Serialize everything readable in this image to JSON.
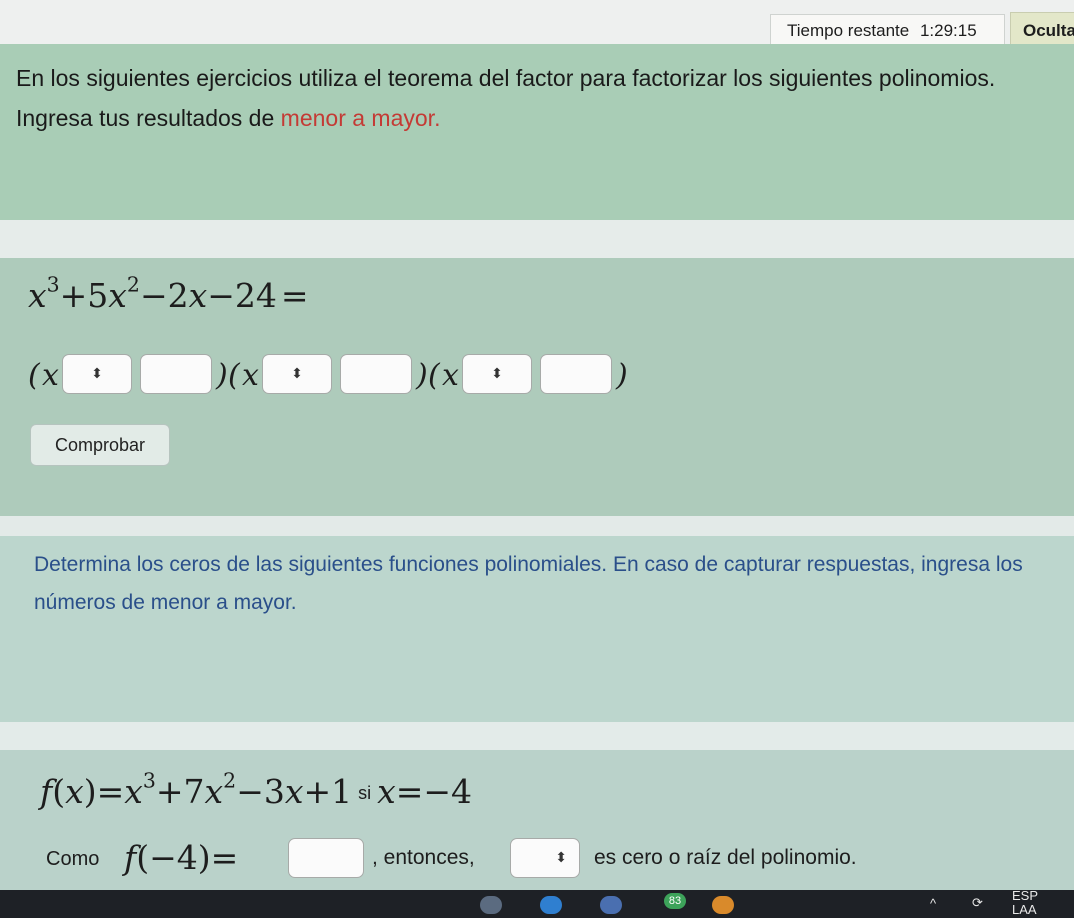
{
  "header": {
    "timer_label": "Tiempo restante",
    "timer_value": "1:29:15",
    "hide_button": "Oculta"
  },
  "section1": {
    "instruction_before": "En los siguientes ejercicios utiliza el teorema del factor para factorizar los siguientes polinomios. Ingresa tus resultados de ",
    "instruction_highlight": "menor a mayor.",
    "highlight_color": "#c43a35",
    "polynomial": {
      "t1": "x",
      "e1": "3",
      "op1": "+",
      "c2": "5",
      "t2": "x",
      "e2": "2",
      "op2": "−",
      "c3": "2",
      "t3": "x",
      "op3": "−",
      "c4": "24",
      "eq": "="
    },
    "factor_open": "(",
    "factor_var": "x",
    "factor_close": ")",
    "select_arrow": "⬍",
    "check_button": "Comprobar"
  },
  "section2": {
    "instruction": "Determina los ceros de las siguientes funciones polinomiales. En caso de capturar respuestas, ingresa los números de menor a mayor.",
    "instruction_color": "#2a4f8a",
    "function": {
      "f": "f",
      "lp": "(",
      "x": "x",
      "rp": ")",
      "eq": "=",
      "t1": "x",
      "e1": "3",
      "op1": "+",
      "c2": "7",
      "t2": "x",
      "e2": "2",
      "op2": "−",
      "c3": "3",
      "t3": "x",
      "op3": "+",
      "c4": "1",
      "si": "si",
      "xv": "x",
      "eq2": "=",
      "val": "−4"
    },
    "como_label": "Como",
    "eval": {
      "f": "f",
      "lp": "(",
      "arg": "−4",
      "rp": ")",
      "eq": "="
    },
    "entonces": ", entonces,",
    "select_arrow": "⬍",
    "conclusion": "es cero o raíz del polinomio."
  },
  "taskbar": {
    "badge": "83",
    "lang": "ESP",
    "layout": "LAA"
  }
}
